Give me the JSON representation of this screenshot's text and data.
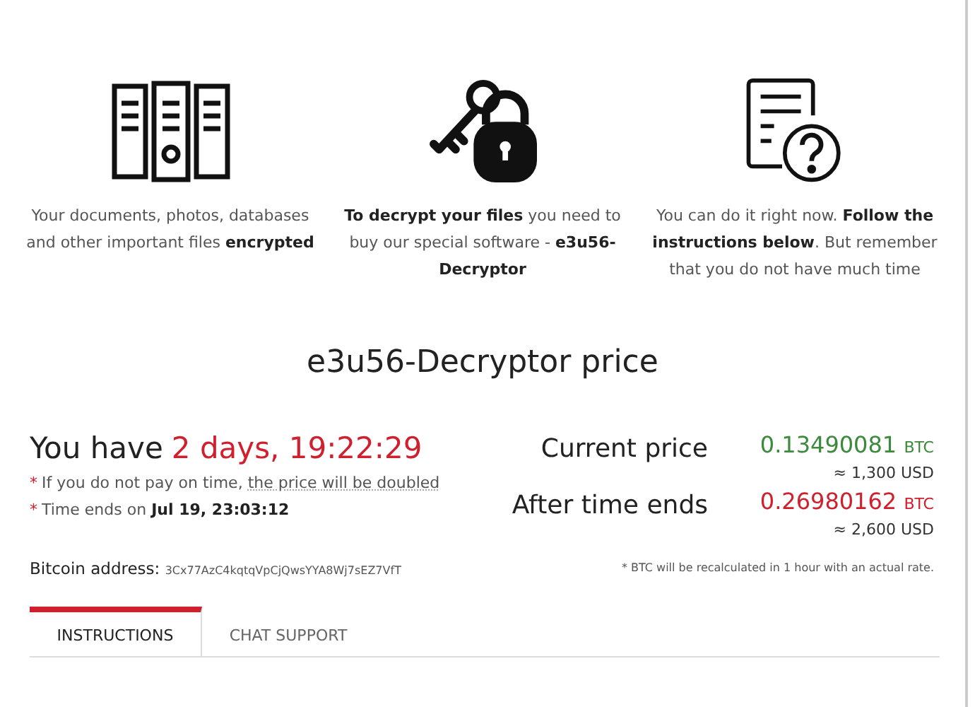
{
  "features": [
    {
      "kind": "files",
      "text": "Your documents, photos, databases and other important files **encrypted**"
    },
    {
      "kind": "key-lock",
      "text": "**To decrypt your files** you need to buy our special software - **e3u56-Decryptor**"
    },
    {
      "kind": "doc-question",
      "text": "You can do it right now. **Follow the instructions below**. But remember that you do not have much time"
    }
  ],
  "title": "e3u56-Decryptor price",
  "countdown": {
    "label": "You have",
    "value": "2 days, 19:22:29"
  },
  "notes": [
    {
      "bullet": "*",
      "text": "If you do not pay on time,",
      "link": "the price will be doubled"
    },
    {
      "bullet": "*",
      "text": "Time ends on **Jul 19, 23:03:12**"
    }
  ],
  "bitcoin": {
    "label": "Bitcoin address:",
    "address": "3Cx77AzC4kqtqVpCjQwsYYA8Wj7sEZ7VfT"
  },
  "prices": [
    {
      "label": "Current price",
      "amount": "0.13490081",
      "unit": "BTC",
      "usd": "≈ 1,300 USD",
      "color": "#3c8a3c"
    },
    {
      "label": "After time ends",
      "amount": "0.26980162",
      "unit": "BTC",
      "usd": "≈ 2,600 USD",
      "color": "#d0202e"
    }
  ],
  "rate_note": "* BTC will be recalculated in 1 hour with an actual rate.",
  "tabs": [
    {
      "label": "INSTRUCTIONS",
      "selected": true
    },
    {
      "label": "CHAT SUPPORT",
      "selected": false
    }
  ]
}
